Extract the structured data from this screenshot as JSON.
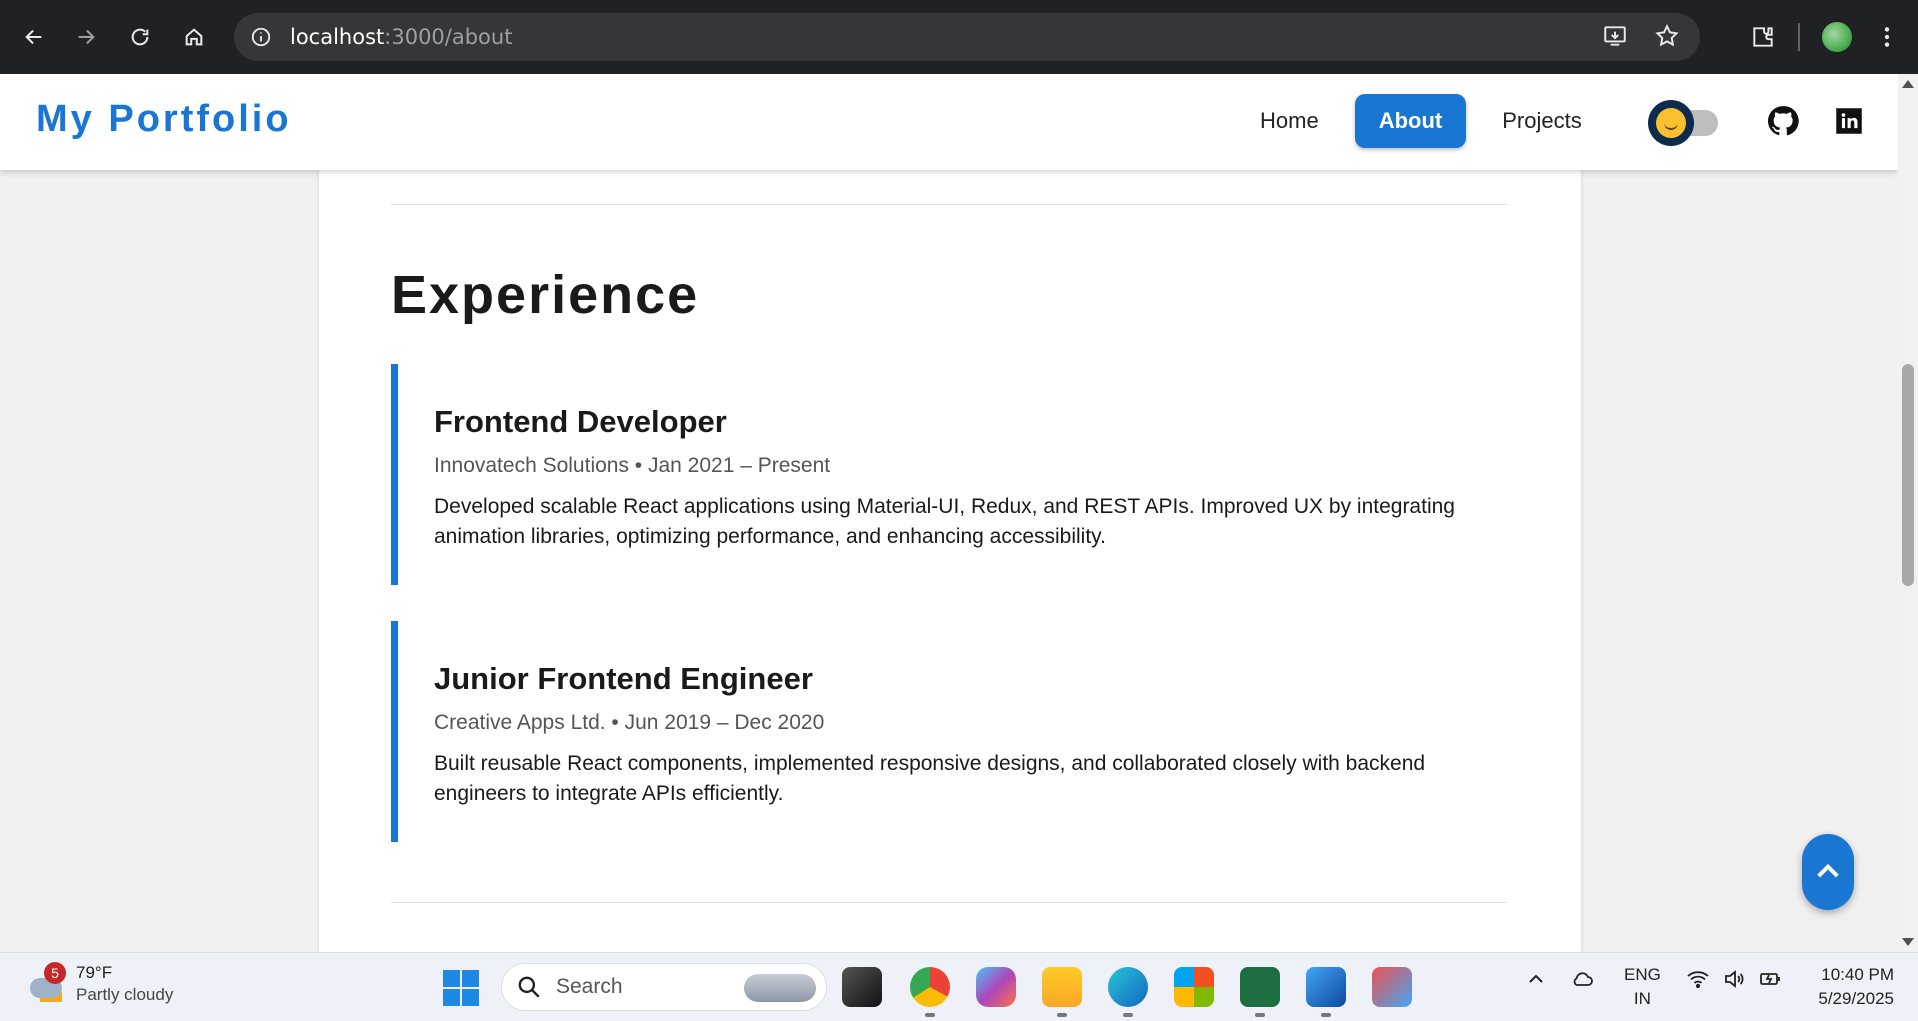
{
  "browser": {
    "url_host": "localhost",
    "url_path": ":3000/about"
  },
  "header": {
    "brand": "My Portfolio",
    "nav": [
      {
        "label": "Home",
        "active": false
      },
      {
        "label": "About",
        "active": true
      },
      {
        "label": "Projects",
        "active": false
      }
    ],
    "theme_toggle_icon": "sun-icon",
    "social_icons": [
      "github-icon",
      "linkedin-icon"
    ]
  },
  "experience": {
    "title": "Experience",
    "items": [
      {
        "role": "Frontend Developer",
        "meta": "Innovatech Solutions • Jan 2021 – Present",
        "description": "Developed scalable React applications using Material-UI, Redux, and REST APIs. Improved UX by integrating animation libraries, optimizing performance, and enhancing accessibility."
      },
      {
        "role": "Junior Frontend Engineer",
        "meta": "Creative Apps Ltd. • Jun 2019 – Dec 2020",
        "description": "Built reusable React components, implemented responsive designs, and collaborated closely with backend engineers to integrate APIs efficiently."
      }
    ]
  },
  "taskbar": {
    "weather_badge": "5",
    "temperature": "79°F",
    "condition": "Partly cloudy",
    "search_label": "Search",
    "lang_1": "ENG",
    "lang_2": "IN",
    "time": "10:40 PM",
    "date": "5/29/2025"
  },
  "colors": {
    "accent": "#1976d2",
    "browser_bg": "#202124"
  }
}
